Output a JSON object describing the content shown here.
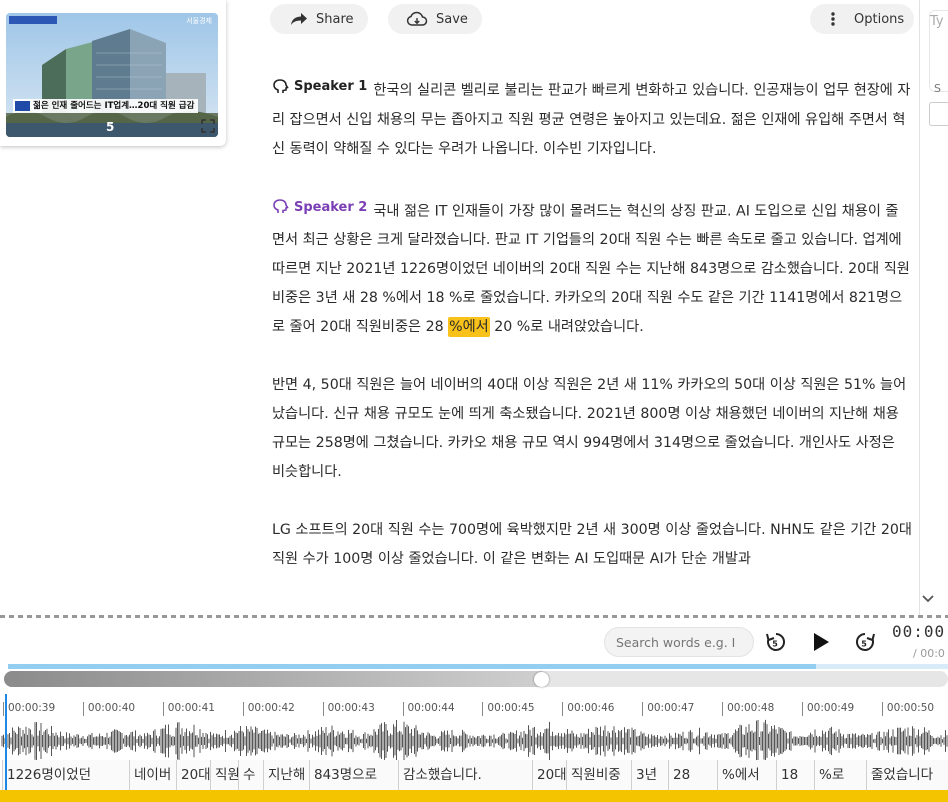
{
  "video": {
    "caption": "젊은 인재 줄어드는 IT업계…20대 직원 급감",
    "channel": "서울경제",
    "logo_text": "5"
  },
  "toolbar": {
    "share_label": "Share",
    "save_label": "Save",
    "options_label": "Options"
  },
  "right_panel": {
    "input_hint": "Ty",
    "letter": "S"
  },
  "transcript": [
    {
      "speaker": "Speaker 1",
      "text": "한국의 실리콘 벨리로 불리는 판교가 빠르게 변화하고 있습니다. 인공재능이 업무 현장에 자리 잡으면서 신입 채용의 무는 좁아지고 직원 평균 연령은 높아지고 있는데요. 젊은 인재에 유입해 주면서 혁신 동력이 약해질 수 있다는 우려가 나옵니다. 이수빈 기자입니다."
    },
    {
      "speaker": "Speaker 2",
      "text_before": "국내 젊은 IT 인재들이 가장 많이 몰려드는 혁신의 상징 판교. AI 도입으로 신입 채용이 줄 면서 최근 상황은 크게 달라졌습니다. 판교 IT 기업들의 20대 직원 수는 빠른 속도로 줄고 있습니다. 업계에 따르면 지난 2021년 1226명이었던 네이버의 20대 직원 수는 지난해 843명으로 감소했습니다. 20대 직원비중은 3년 새 28 %에서 18 %로 줄었습니다. 카카오의 20대 직원 수도 같은 기간 1141명에서 821명으로 줄어 20대 직원비중은 28 ",
      "highlight": "%에서",
      "text_after": " 20 %로 내려앉았습니다."
    },
    {
      "text": "반면 4, 50대 직원은 늘어 네이버의 40대 이상 직원은 2년 새 11% 카카오의 50대 이상 직원은 51% 늘어났습니다. 신규 채용 규모도 눈에 띄게 축소됐습니다. 2021년 800명 이상 채용했던 네이버의 지난해 채용 규모는 258명에 그쳤습니다. 카카오 채용 규모 역시 994명에서 314명으로 줄었습니다. 개인사도 사정은 비슷합니다."
    },
    {
      "text": "LG 소프트의 20대 직원 수는 700명에 육박했지만 2년 새 300명 이상 줄었습니다. NHN도 같은 기간 20대 직원 수가 100명 이상 줄었습니다. 이 같은 변화는 AI 도입때문 AI가 단순 개발과"
    }
  ],
  "player": {
    "search_placeholder": "Search words e.g. I",
    "time_current": "00:00",
    "time_total": "/ 00:0",
    "progress_fraction": 0.86,
    "scrub_fraction": 0.57
  },
  "timeline": {
    "ticks": [
      "00:00:39",
      "00:00:40",
      "00:00:41",
      "00:00:42",
      "00:00:43",
      "00:00:44",
      "00:00:45",
      "00:00:46",
      "00:00:47",
      "00:00:48",
      "00:00:49",
      "00:00:50"
    ],
    "words": [
      "1226명이었던",
      "네이버",
      "20대",
      "직원",
      "수",
      "지난해",
      "843명으로",
      "감소했습니다.",
      "20대",
      "직원비중",
      "3년",
      "28",
      "%에서",
      "18",
      "%로",
      "줄었습니다"
    ]
  },
  "colors": {
    "highlight": "#f9c21a",
    "speaker2": "#7b3fb5",
    "accent_bar": "#f5c400",
    "progress": "#93cdf0",
    "playhead": "#1e88e5"
  }
}
